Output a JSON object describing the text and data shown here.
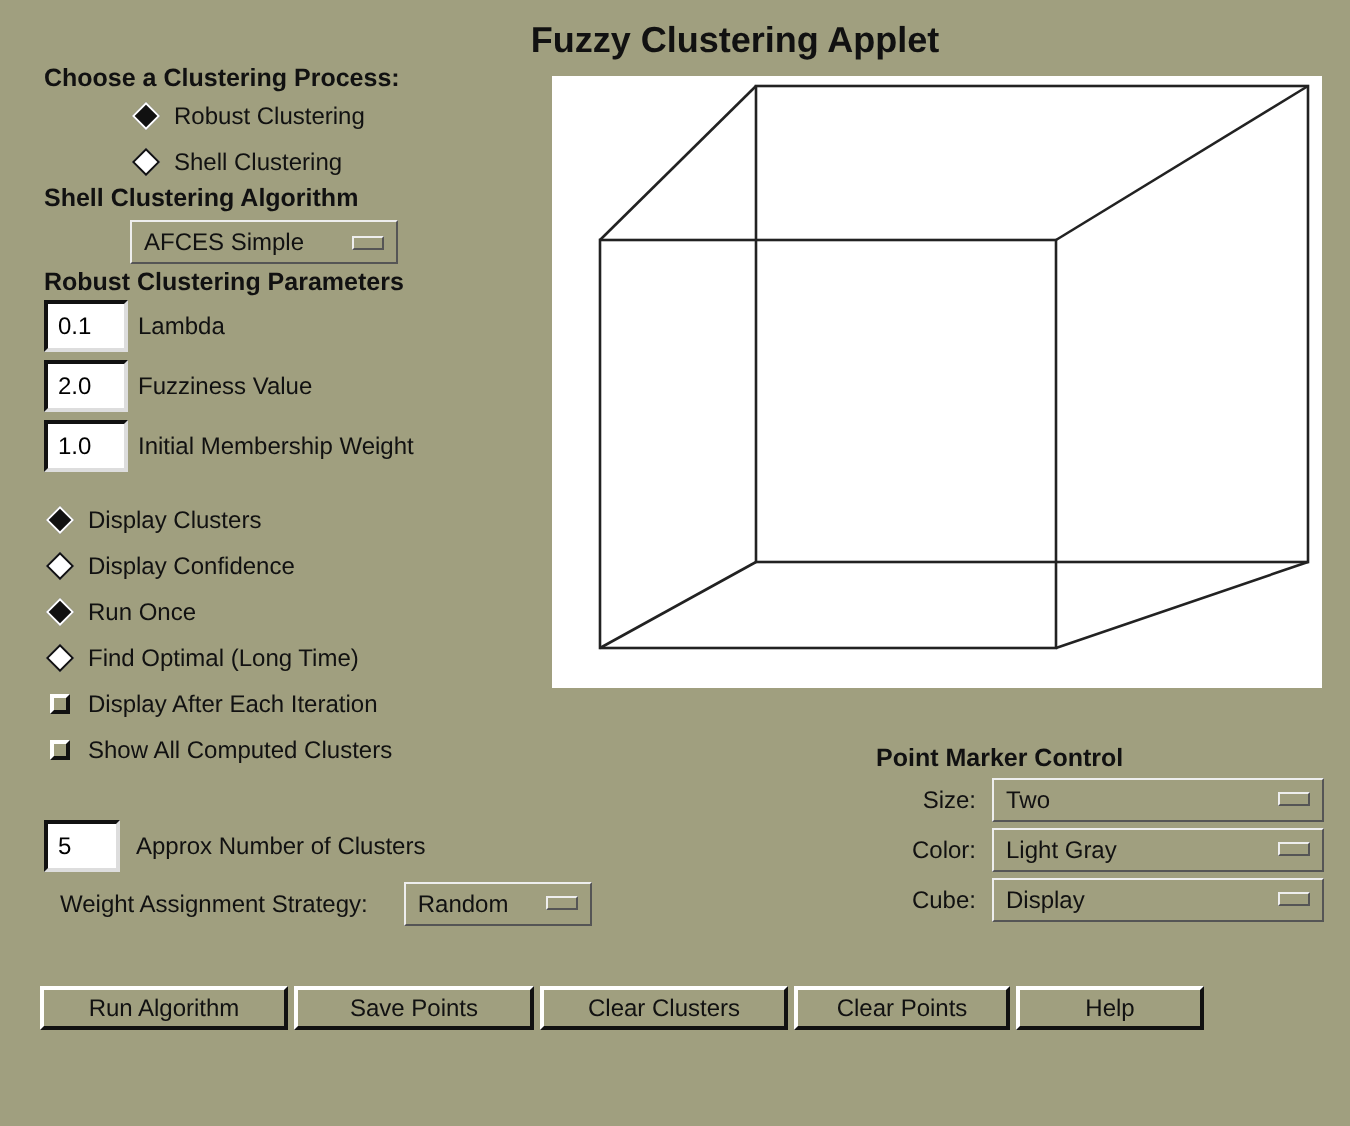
{
  "title": "Fuzzy Clustering Applet",
  "process": {
    "label": "Choose a Clustering Process:",
    "options": [
      {
        "label": "Robust Clustering",
        "selected": true
      },
      {
        "label": "Shell Clustering",
        "selected": false
      }
    ]
  },
  "algorithm": {
    "label": "Shell Clustering Algorithm",
    "value": "AFCES Simple"
  },
  "parameters": {
    "label": "Robust Clustering Parameters",
    "fields": [
      {
        "value": "0.1",
        "label": "Lambda"
      },
      {
        "value": "2.0",
        "label": "Fuzziness Value"
      },
      {
        "value": "1.0",
        "label": "Initial Membership Weight"
      }
    ]
  },
  "display_options": [
    {
      "label": "Display Clusters",
      "selected": true
    },
    {
      "label": "Display Confidence",
      "selected": false
    }
  ],
  "run_options": [
    {
      "label": "Run Once",
      "selected": true
    },
    {
      "label": "Find Optimal (Long Time)",
      "selected": false
    }
  ],
  "checkboxes": [
    {
      "label": "Display After Each Iteration",
      "checked": false
    },
    {
      "label": "Show All Computed Clusters",
      "checked": false
    }
  ],
  "clusters": {
    "value": "5",
    "label": "Approx Number of Clusters"
  },
  "weight": {
    "label": "Weight Assignment Strategy:",
    "value": "Random"
  },
  "marker": {
    "title": "Point Marker Control",
    "rows": [
      {
        "label": "Size:",
        "value": "Two"
      },
      {
        "label": "Color:",
        "value": "Light Gray"
      },
      {
        "label": "Cube:",
        "value": "Display"
      }
    ]
  },
  "buttons": [
    "Run Algorithm",
    "Save Points",
    "Clear Clusters",
    "Clear Points",
    "Help"
  ]
}
